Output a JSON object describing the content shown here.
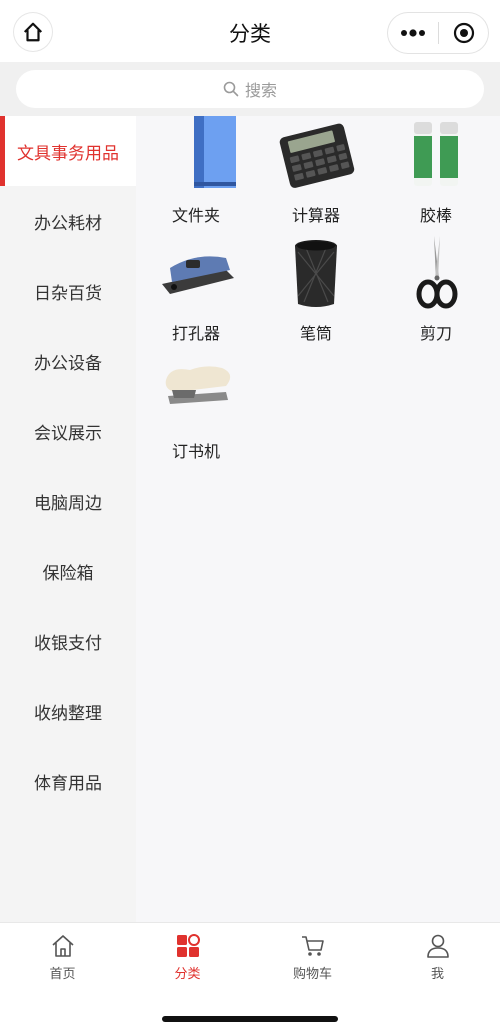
{
  "header": {
    "title": "分类"
  },
  "search": {
    "placeholder": "搜索"
  },
  "sidebar": {
    "items": [
      {
        "label": "文具事务用品",
        "active": true
      },
      {
        "label": "办公耗材"
      },
      {
        "label": "日杂百货"
      },
      {
        "label": "办公设备"
      },
      {
        "label": "会议展示"
      },
      {
        "label": "电脑周边"
      },
      {
        "label": "保险箱"
      },
      {
        "label": "收银支付"
      },
      {
        "label": "收纳整理"
      },
      {
        "label": "体育用品"
      }
    ]
  },
  "products": [
    {
      "name": "文件夹",
      "icon": "folder-image"
    },
    {
      "name": "计算器",
      "icon": "calculator-image"
    },
    {
      "name": "胶棒",
      "icon": "glue-stick-image"
    },
    {
      "name": "打孔器",
      "icon": "hole-punch-image"
    },
    {
      "name": "笔筒",
      "icon": "pen-holder-image"
    },
    {
      "name": "剪刀",
      "icon": "scissors-image"
    },
    {
      "name": "订书机",
      "icon": "stapler-image"
    }
  ],
  "tabbar": {
    "items": [
      {
        "label": "首页",
        "icon": "home-icon"
      },
      {
        "label": "分类",
        "icon": "category-icon",
        "active": true
      },
      {
        "label": "购物车",
        "icon": "cart-icon"
      },
      {
        "label": "我",
        "icon": "user-icon"
      }
    ]
  },
  "colors": {
    "accent": "#e0322e",
    "sidebar_bg": "#f4f4f4",
    "content_bg": "#f7f7f9"
  }
}
